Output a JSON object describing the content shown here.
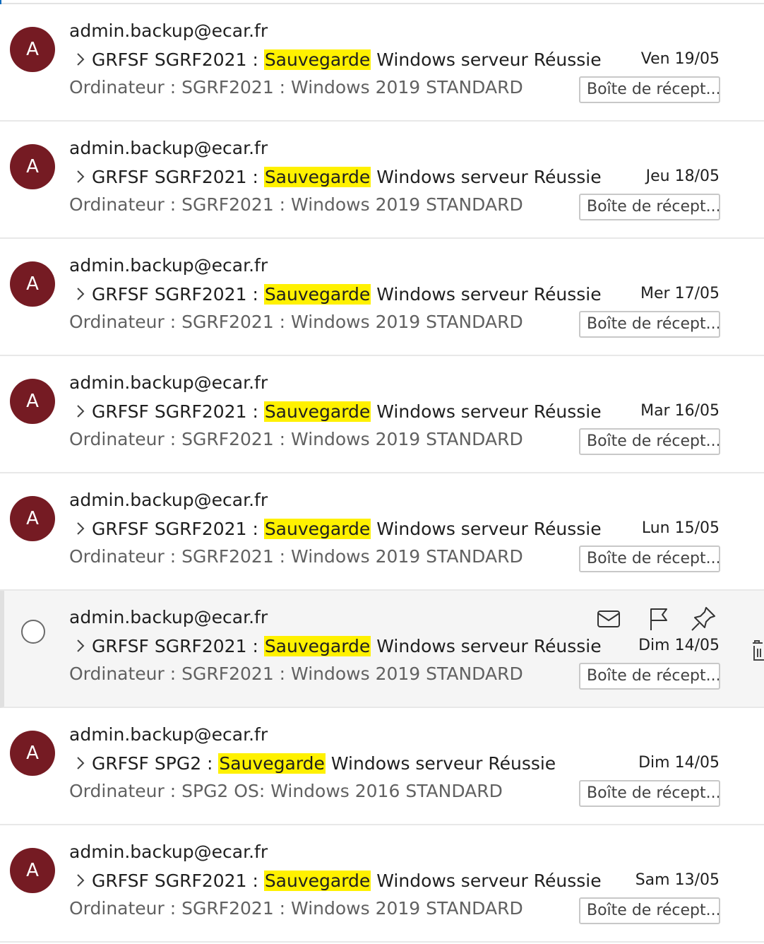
{
  "emails": [
    {
      "avatar_initial": "A",
      "sender": "admin.backup@ecar.fr",
      "subject_prefix": "GRFSF SGRF2021 : ",
      "subject_highlight": "Sauvegarde",
      "subject_suffix": " Windows serveur Réussie",
      "date": "Ven 19/05",
      "preview": "Ordinateur : SGRF2021 : Windows 2019 STANDARD",
      "folder": "Boîte de récept..."
    },
    {
      "avatar_initial": "A",
      "sender": "admin.backup@ecar.fr",
      "subject_prefix": "GRFSF SGRF2021 : ",
      "subject_highlight": "Sauvegarde",
      "subject_suffix": " Windows serveur Réussie",
      "date": "Jeu 18/05",
      "preview": "Ordinateur : SGRF2021 : Windows 2019 STANDARD",
      "folder": "Boîte de récept..."
    },
    {
      "avatar_initial": "A",
      "sender": "admin.backup@ecar.fr",
      "subject_prefix": "GRFSF SGRF2021 : ",
      "subject_highlight": "Sauvegarde",
      "subject_suffix": " Windows serveur Réussie",
      "date": "Mer 17/05",
      "preview": "Ordinateur : SGRF2021 : Windows 2019 STANDARD",
      "folder": "Boîte de récept..."
    },
    {
      "avatar_initial": "A",
      "sender": "admin.backup@ecar.fr",
      "subject_prefix": "GRFSF SGRF2021 : ",
      "subject_highlight": "Sauvegarde",
      "subject_suffix": " Windows serveur Réussie",
      "date": "Mar 16/05",
      "preview": "Ordinateur : SGRF2021 : Windows 2019 STANDARD",
      "folder": "Boîte de récept..."
    },
    {
      "avatar_initial": "A",
      "sender": "admin.backup@ecar.fr",
      "subject_prefix": "GRFSF SGRF2021 : ",
      "subject_highlight": "Sauvegarde",
      "subject_suffix": " Windows serveur Réussie",
      "date": "Lun 15/05",
      "preview": "Ordinateur : SGRF2021 : Windows 2019 STANDARD",
      "folder": "Boîte de récept..."
    },
    {
      "avatar_initial": "",
      "sender": "admin.backup@ecar.fr",
      "subject_prefix": "GRFSF SGRF2021 : ",
      "subject_highlight": "Sauvegarde",
      "subject_suffix": " Windows serveur Réussie",
      "date": "Dim 14/05",
      "preview": "Ordinateur : SGRF2021 : Windows 2019 STANDARD",
      "folder": "Boîte de récept..."
    },
    {
      "avatar_initial": "A",
      "sender": "admin.backup@ecar.fr",
      "subject_prefix": "GRFSF SPG2 : ",
      "subject_highlight": "Sauvegarde",
      "subject_suffix": " Windows serveur Réussie",
      "date": "Dim 14/05",
      "preview": "Ordinateur : SPG2 OS: Windows 2016 STANDARD",
      "folder": "Boîte de récept..."
    },
    {
      "avatar_initial": "A",
      "sender": "admin.backup@ecar.fr",
      "subject_prefix": "GRFSF SGRF2021 : ",
      "subject_highlight": "Sauvegarde",
      "subject_suffix": " Windows serveur Réussie",
      "date": "Sam 13/05",
      "preview": "Ordinateur : SGRF2021 : Windows 2019 STANDARD",
      "folder": "Boîte de récept..."
    }
  ],
  "hover_actions": [
    "mail-icon",
    "flag-icon",
    "pin-icon"
  ],
  "hover_trailing_icon": "trash-icon",
  "colors": {
    "avatar_bg": "#751b23",
    "highlight": "#fff100",
    "hover_row_bg": "#f5f5f5",
    "accent": "#0f6cbd"
  }
}
